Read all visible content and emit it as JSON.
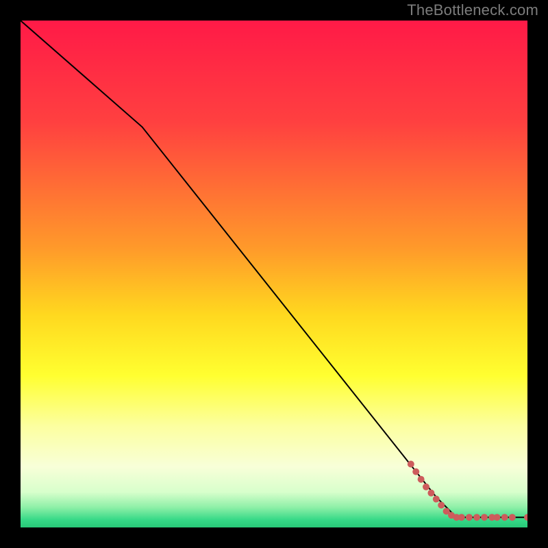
{
  "watermark": "TheBottleneck.com",
  "chart_data": {
    "type": "line",
    "title": "",
    "xlabel": "",
    "ylabel": "",
    "xlim": [
      0,
      100
    ],
    "ylim": [
      0,
      100
    ],
    "grid": false,
    "legend": false,
    "gradient_stops": [
      {
        "offset": 0.0,
        "color": "#ff1a47"
      },
      {
        "offset": 0.2,
        "color": "#ff4040"
      },
      {
        "offset": 0.45,
        "color": "#ff9a2a"
      },
      {
        "offset": 0.58,
        "color": "#ffd81f"
      },
      {
        "offset": 0.7,
        "color": "#ffff30"
      },
      {
        "offset": 0.8,
        "color": "#fcffa0"
      },
      {
        "offset": 0.88,
        "color": "#f8ffd8"
      },
      {
        "offset": 0.93,
        "color": "#d8ffcc"
      },
      {
        "offset": 0.96,
        "color": "#8ff0a8"
      },
      {
        "offset": 0.985,
        "color": "#36d987"
      },
      {
        "offset": 1.0,
        "color": "#28c878"
      }
    ],
    "series": [
      {
        "name": "bottleneck-curve",
        "color": "#000000",
        "stroke_width": 2,
        "points": [
          {
            "x": 0,
            "y": 100
          },
          {
            "x": 24,
            "y": 79
          },
          {
            "x": 82,
            "y": 6
          },
          {
            "x": 86,
            "y": 2
          },
          {
            "x": 100,
            "y": 2
          }
        ]
      }
    ],
    "markers": {
      "name": "data-points",
      "color": "#cd5c5c",
      "radius": 5,
      "points": [
        {
          "x": 77,
          "y": 12.5
        },
        {
          "x": 78,
          "y": 11.0
        },
        {
          "x": 79,
          "y": 9.5
        },
        {
          "x": 80,
          "y": 8.0
        },
        {
          "x": 81,
          "y": 6.8
        },
        {
          "x": 82,
          "y": 5.6
        },
        {
          "x": 83,
          "y": 4.4
        },
        {
          "x": 84,
          "y": 3.2
        },
        {
          "x": 85,
          "y": 2.4
        },
        {
          "x": 86,
          "y": 2.0
        },
        {
          "x": 87,
          "y": 2.0
        },
        {
          "x": 88.5,
          "y": 2.0
        },
        {
          "x": 90,
          "y": 2.0
        },
        {
          "x": 91.5,
          "y": 2.0
        },
        {
          "x": 93,
          "y": 2.0
        },
        {
          "x": 94,
          "y": 2.0
        },
        {
          "x": 95.5,
          "y": 2.0
        },
        {
          "x": 97,
          "y": 2.0
        },
        {
          "x": 100,
          "y": 2.0
        }
      ]
    }
  }
}
